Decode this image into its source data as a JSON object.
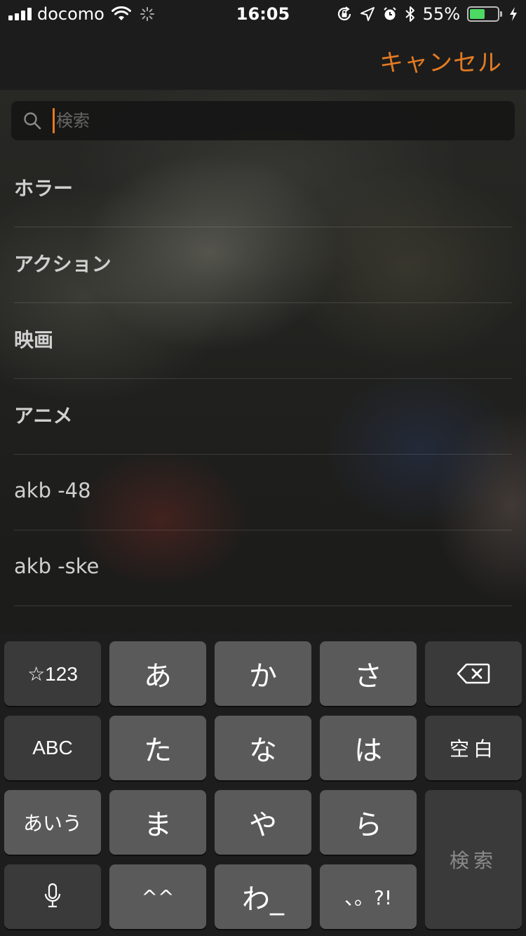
{
  "status_bar": {
    "carrier": "docomo",
    "time": "16:05",
    "battery_percent": "55%",
    "battery_level": 0.55
  },
  "nav": {
    "cancel_label": "キャンセル"
  },
  "search": {
    "placeholder": "検索",
    "value": ""
  },
  "suggestions": [
    "ホラー",
    "アクション",
    "映画",
    "アニメ",
    "akb -48",
    "akb -ske"
  ],
  "keyboard": {
    "symbols_key": "☆123",
    "abc_key": "ABC",
    "kana_mode_key": "あいう",
    "mic_key_icon": "microphone-icon",
    "delete_key_icon": "delete-icon",
    "space_key": "空白",
    "search_key": "検索",
    "kana_keys": [
      "あ",
      "か",
      "さ",
      "た",
      "な",
      "は",
      "ま",
      "や",
      "ら",
      "^^",
      "わ_",
      "、。?!"
    ]
  },
  "colors": {
    "accent": "#e47b22",
    "battery_green": "#4cd964"
  }
}
